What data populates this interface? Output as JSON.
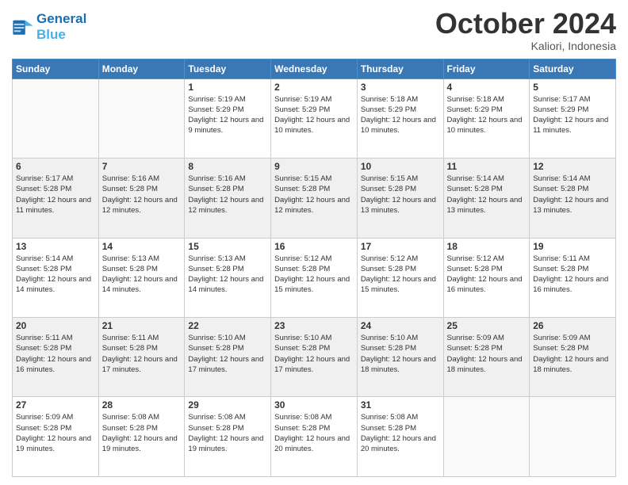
{
  "header": {
    "logo_line1": "General",
    "logo_line2": "Blue",
    "month": "October 2024",
    "location": "Kaliori, Indonesia"
  },
  "weekdays": [
    "Sunday",
    "Monday",
    "Tuesday",
    "Wednesday",
    "Thursday",
    "Friday",
    "Saturday"
  ],
  "weeks": [
    [
      {
        "day": null,
        "info": ""
      },
      {
        "day": null,
        "info": ""
      },
      {
        "day": "1",
        "info": "Sunrise: 5:19 AM\nSunset: 5:29 PM\nDaylight: 12 hours and 9 minutes."
      },
      {
        "day": "2",
        "info": "Sunrise: 5:19 AM\nSunset: 5:29 PM\nDaylight: 12 hours and 10 minutes."
      },
      {
        "day": "3",
        "info": "Sunrise: 5:18 AM\nSunset: 5:29 PM\nDaylight: 12 hours and 10 minutes."
      },
      {
        "day": "4",
        "info": "Sunrise: 5:18 AM\nSunset: 5:29 PM\nDaylight: 12 hours and 10 minutes."
      },
      {
        "day": "5",
        "info": "Sunrise: 5:17 AM\nSunset: 5:29 PM\nDaylight: 12 hours and 11 minutes."
      }
    ],
    [
      {
        "day": "6",
        "info": "Sunrise: 5:17 AM\nSunset: 5:28 PM\nDaylight: 12 hours and 11 minutes."
      },
      {
        "day": "7",
        "info": "Sunrise: 5:16 AM\nSunset: 5:28 PM\nDaylight: 12 hours and 12 minutes."
      },
      {
        "day": "8",
        "info": "Sunrise: 5:16 AM\nSunset: 5:28 PM\nDaylight: 12 hours and 12 minutes."
      },
      {
        "day": "9",
        "info": "Sunrise: 5:15 AM\nSunset: 5:28 PM\nDaylight: 12 hours and 12 minutes."
      },
      {
        "day": "10",
        "info": "Sunrise: 5:15 AM\nSunset: 5:28 PM\nDaylight: 12 hours and 13 minutes."
      },
      {
        "day": "11",
        "info": "Sunrise: 5:14 AM\nSunset: 5:28 PM\nDaylight: 12 hours and 13 minutes."
      },
      {
        "day": "12",
        "info": "Sunrise: 5:14 AM\nSunset: 5:28 PM\nDaylight: 12 hours and 13 minutes."
      }
    ],
    [
      {
        "day": "13",
        "info": "Sunrise: 5:14 AM\nSunset: 5:28 PM\nDaylight: 12 hours and 14 minutes."
      },
      {
        "day": "14",
        "info": "Sunrise: 5:13 AM\nSunset: 5:28 PM\nDaylight: 12 hours and 14 minutes."
      },
      {
        "day": "15",
        "info": "Sunrise: 5:13 AM\nSunset: 5:28 PM\nDaylight: 12 hours and 14 minutes."
      },
      {
        "day": "16",
        "info": "Sunrise: 5:12 AM\nSunset: 5:28 PM\nDaylight: 12 hours and 15 minutes."
      },
      {
        "day": "17",
        "info": "Sunrise: 5:12 AM\nSunset: 5:28 PM\nDaylight: 12 hours and 15 minutes."
      },
      {
        "day": "18",
        "info": "Sunrise: 5:12 AM\nSunset: 5:28 PM\nDaylight: 12 hours and 16 minutes."
      },
      {
        "day": "19",
        "info": "Sunrise: 5:11 AM\nSunset: 5:28 PM\nDaylight: 12 hours and 16 minutes."
      }
    ],
    [
      {
        "day": "20",
        "info": "Sunrise: 5:11 AM\nSunset: 5:28 PM\nDaylight: 12 hours and 16 minutes."
      },
      {
        "day": "21",
        "info": "Sunrise: 5:11 AM\nSunset: 5:28 PM\nDaylight: 12 hours and 17 minutes."
      },
      {
        "day": "22",
        "info": "Sunrise: 5:10 AM\nSunset: 5:28 PM\nDaylight: 12 hours and 17 minutes."
      },
      {
        "day": "23",
        "info": "Sunrise: 5:10 AM\nSunset: 5:28 PM\nDaylight: 12 hours and 17 minutes."
      },
      {
        "day": "24",
        "info": "Sunrise: 5:10 AM\nSunset: 5:28 PM\nDaylight: 12 hours and 18 minutes."
      },
      {
        "day": "25",
        "info": "Sunrise: 5:09 AM\nSunset: 5:28 PM\nDaylight: 12 hours and 18 minutes."
      },
      {
        "day": "26",
        "info": "Sunrise: 5:09 AM\nSunset: 5:28 PM\nDaylight: 12 hours and 18 minutes."
      }
    ],
    [
      {
        "day": "27",
        "info": "Sunrise: 5:09 AM\nSunset: 5:28 PM\nDaylight: 12 hours and 19 minutes."
      },
      {
        "day": "28",
        "info": "Sunrise: 5:08 AM\nSunset: 5:28 PM\nDaylight: 12 hours and 19 minutes."
      },
      {
        "day": "29",
        "info": "Sunrise: 5:08 AM\nSunset: 5:28 PM\nDaylight: 12 hours and 19 minutes."
      },
      {
        "day": "30",
        "info": "Sunrise: 5:08 AM\nSunset: 5:28 PM\nDaylight: 12 hours and 20 minutes."
      },
      {
        "day": "31",
        "info": "Sunrise: 5:08 AM\nSunset: 5:28 PM\nDaylight: 12 hours and 20 minutes."
      },
      {
        "day": null,
        "info": ""
      },
      {
        "day": null,
        "info": ""
      }
    ]
  ]
}
